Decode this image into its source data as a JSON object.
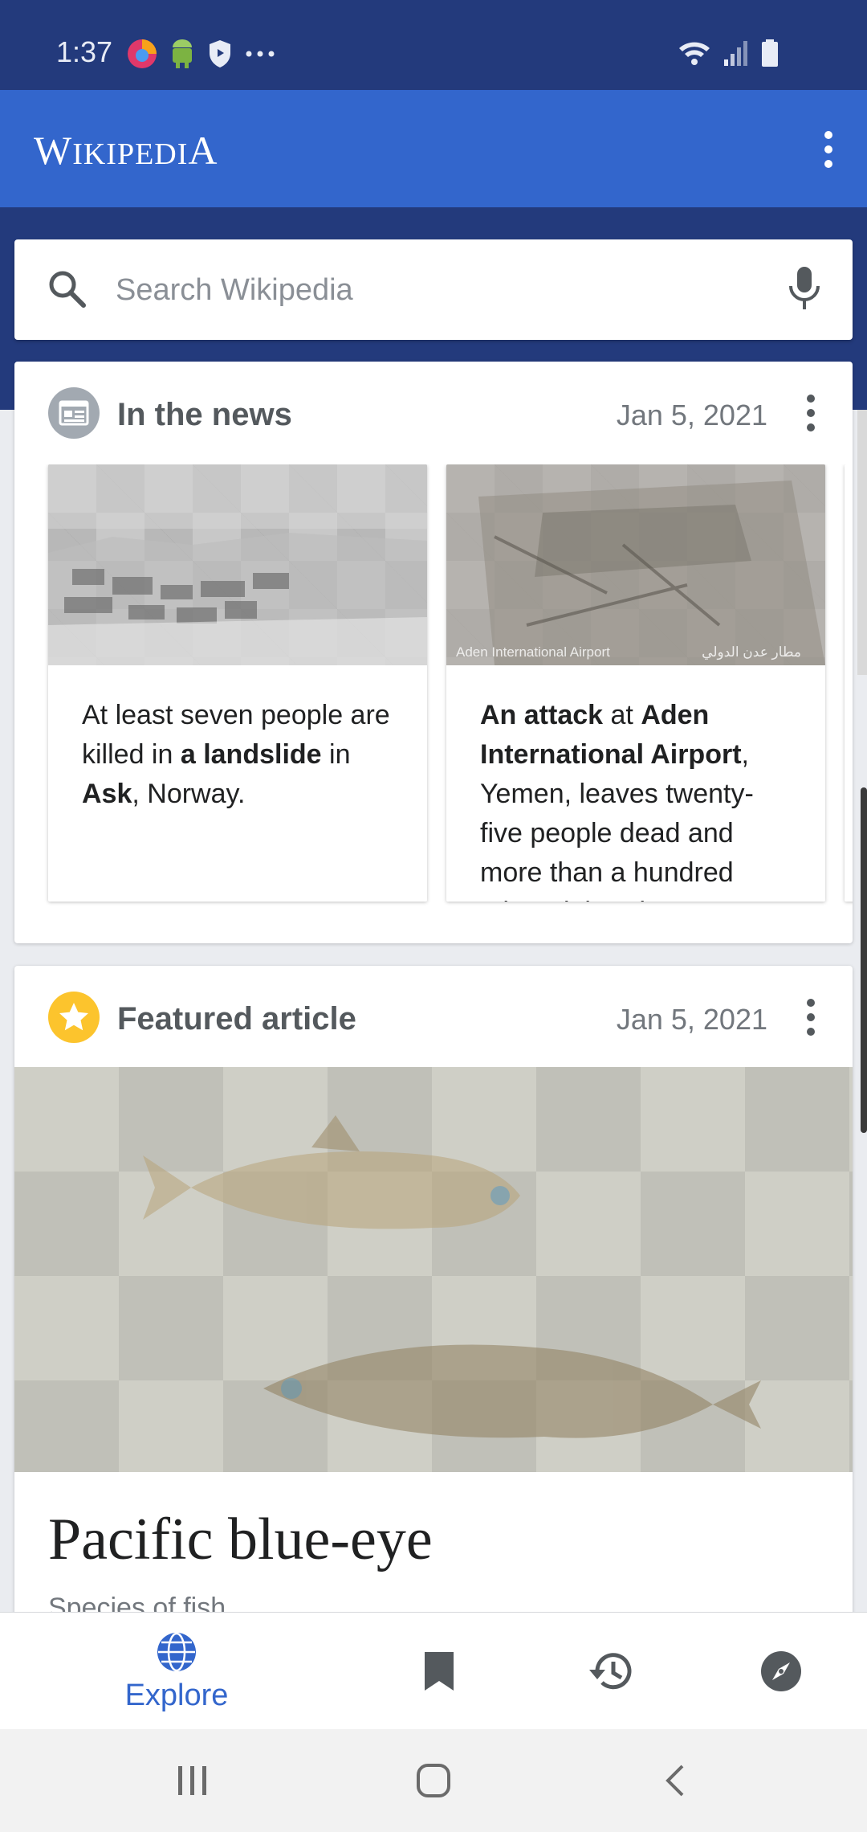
{
  "status_bar": {
    "time": "1:37",
    "left_icons": [
      "firefox-icon",
      "android-icon",
      "shield-icon",
      "more-dots-icon"
    ],
    "right_icons": [
      "wifi-icon",
      "signal-icon",
      "battery-icon"
    ]
  },
  "app_bar": {
    "logo": "Wikipedia",
    "logo_first": "W",
    "logo_mid": "IKIPEDI",
    "logo_last": "A",
    "overflow_icon": "overflow-menu-icon"
  },
  "search": {
    "placeholder": "Search Wikipedia",
    "value": ""
  },
  "news": {
    "title": "In the news",
    "date": "Jan 5, 2021",
    "items": [
      {
        "parts": [
          "At least seven people are killed in ",
          "a landslide",
          " in ",
          "Ask",
          ", Norway."
        ]
      },
      {
        "image_caption": "Aden International Airport",
        "image_caption_ar": "مطار عدن الدولي",
        "parts": [
          "An attack",
          " at ",
          "Aden International Airport",
          ", Yemen, leaves twenty-five people dead and more than a hundred others injured."
        ]
      }
    ]
  },
  "featured": {
    "title": "Featured article",
    "date": "Jan 5, 2021",
    "article_title": "Pacific blue-eye",
    "article_subtitle": "Species of fish"
  },
  "bottom_nav": {
    "items": [
      {
        "label": "Explore",
        "icon": "globe-icon",
        "active": true
      },
      {
        "label": "",
        "icon": "bookmark-icon",
        "active": false
      },
      {
        "label": "",
        "icon": "history-icon",
        "active": false
      },
      {
        "label": "",
        "icon": "compass-icon",
        "active": false
      }
    ]
  },
  "colors": {
    "brand_blue": "#3366cc",
    "status_bar": "#233a7c",
    "featured_star": "#fcc42d"
  }
}
